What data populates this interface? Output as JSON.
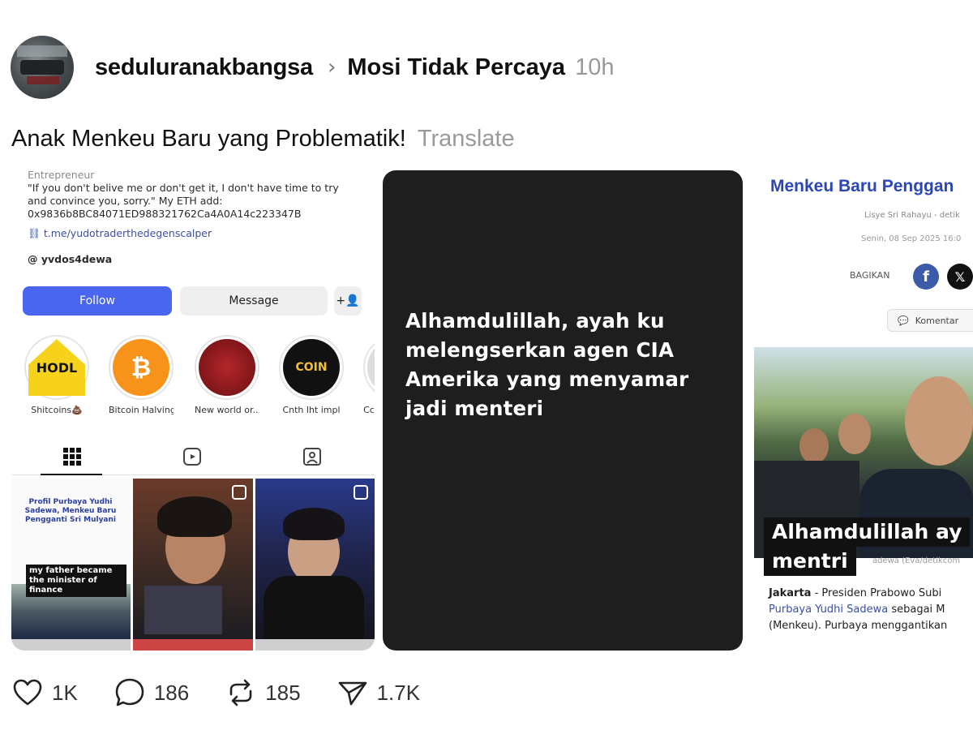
{
  "post": {
    "username": "seduluranakbangsa",
    "community": "Mosi Tidak Percaya",
    "time": "10h",
    "caption": "Anak Menkeu Baru yang Problematik!",
    "translate_label": "Translate"
  },
  "media1": {
    "entrepreneur": "Entrepreneur",
    "bio": "\"If you don't belive me or don't get it, I don't have time to try and convince you, sorry.\" My ETH add: 0x9836b8BC84071ED988321762Ca4A0A14c223347B",
    "link": "t.me/yudotraderthedegenscalper",
    "threads_handle": "yvdos4dewa",
    "follow_label": "Follow",
    "message_label": "Message",
    "highlights": [
      {
        "label": "Shitcoins💩",
        "text": "HODL"
      },
      {
        "label": "Bitcoin Halving",
        "text": "₿"
      },
      {
        "label": "New world or...",
        "text": ""
      },
      {
        "label": "Cnth lht impl",
        "text": "COIN"
      },
      {
        "label": "Cc",
        "text": ""
      }
    ],
    "post1_title": "Profil Purbaya Yudhi Sadewa, Menkeu Baru Pengganti Sri Mulyani",
    "post1_overlay": "my father became the minister of finance"
  },
  "media2": {
    "text": "Alhamdulillah, ayah ku melengserkan agen CIA Amerika yang menyamar jadi menteri"
  },
  "media3": {
    "title": "Menkeu Baru Penggan",
    "author": "Lisye Sri Rahayu - detik",
    "date": "Senin, 08 Sep 2025 16:0",
    "share_label": "BAGIKAN",
    "comment_label": "Komentar",
    "overlay1": "Alhamdulillah ay",
    "overlay2": "mentri",
    "credit": "adewa (Eva/detikcom",
    "body_city": "Jakarta",
    "body_line1": " - Presiden Prabowo Subi",
    "body_link": "Purbaya Yudhi Sadewa",
    "body_line2": " sebagai M",
    "body_line3": "(Menkeu). Purbaya menggantikan"
  },
  "actions": {
    "likes": "1K",
    "comments": "186",
    "reposts": "185",
    "shares": "1.7K"
  },
  "icons": [
    "heart-icon",
    "comment-icon",
    "repost-icon",
    "share-icon",
    "chevron-right-icon",
    "link-icon",
    "threads-icon",
    "add-person-icon",
    "grid-icon",
    "reels-icon",
    "tagged-icon",
    "facebook-icon",
    "x-icon",
    "comment-bubble-icon"
  ]
}
